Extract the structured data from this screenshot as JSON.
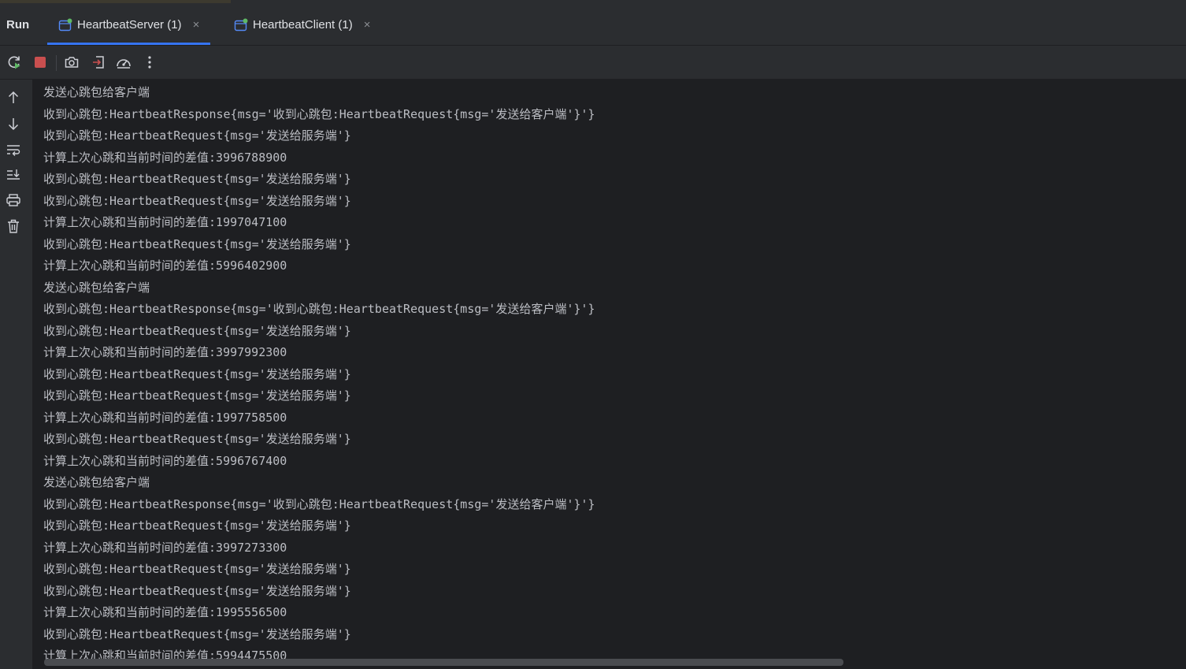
{
  "header": {
    "run_label": "Run",
    "tabs": [
      {
        "label": "HeartbeatServer (1)",
        "active": true
      },
      {
        "label": "HeartbeatClient (1)",
        "active": false
      }
    ],
    "close_glyph": "×"
  },
  "toolbar": {
    "icons": [
      "rerun-icon",
      "stop-icon",
      "screenshot-icon",
      "restore-layout-icon",
      "performance-icon",
      "more-options-icon"
    ]
  },
  "sidebar": {
    "icons": [
      "scroll-up-icon",
      "scroll-down-icon",
      "soft-wrap-icon",
      "scroll-to-end-icon",
      "print-icon",
      "clear-all-icon"
    ]
  },
  "colors": {
    "accent": "#3574f0",
    "stop_red": "#c94f4f",
    "rerun_green": "#5fb865"
  },
  "console": {
    "lines": [
      "发送心跳包给客户端",
      "收到心跳包:HeartbeatResponse{msg='收到心跳包:HeartbeatRequest{msg='发送给客户端'}'}",
      "收到心跳包:HeartbeatRequest{msg='发送给服务端'}",
      "计算上次心跳和当前时间的差值:3996788900",
      "收到心跳包:HeartbeatRequest{msg='发送给服务端'}",
      "收到心跳包:HeartbeatRequest{msg='发送给服务端'}",
      "计算上次心跳和当前时间的差值:1997047100",
      "收到心跳包:HeartbeatRequest{msg='发送给服务端'}",
      "计算上次心跳和当前时间的差值:5996402900",
      "发送心跳包给客户端",
      "收到心跳包:HeartbeatResponse{msg='收到心跳包:HeartbeatRequest{msg='发送给客户端'}'}",
      "收到心跳包:HeartbeatRequest{msg='发送给服务端'}",
      "计算上次心跳和当前时间的差值:3997992300",
      "收到心跳包:HeartbeatRequest{msg='发送给服务端'}",
      "收到心跳包:HeartbeatRequest{msg='发送给服务端'}",
      "计算上次心跳和当前时间的差值:1997758500",
      "收到心跳包:HeartbeatRequest{msg='发送给服务端'}",
      "计算上次心跳和当前时间的差值:5996767400",
      "发送心跳包给客户端",
      "收到心跳包:HeartbeatResponse{msg='收到心跳包:HeartbeatRequest{msg='发送给客户端'}'}",
      "收到心跳包:HeartbeatRequest{msg='发送给服务端'}",
      "计算上次心跳和当前时间的差值:3997273300",
      "收到心跳包:HeartbeatRequest{msg='发送给服务端'}",
      "收到心跳包:HeartbeatRequest{msg='发送给服务端'}",
      "计算上次心跳和当前时间的差值:1995556500",
      "收到心跳包:HeartbeatRequest{msg='发送给服务端'}",
      "计算上次心跳和当前时间的差值:5994475500"
    ]
  }
}
